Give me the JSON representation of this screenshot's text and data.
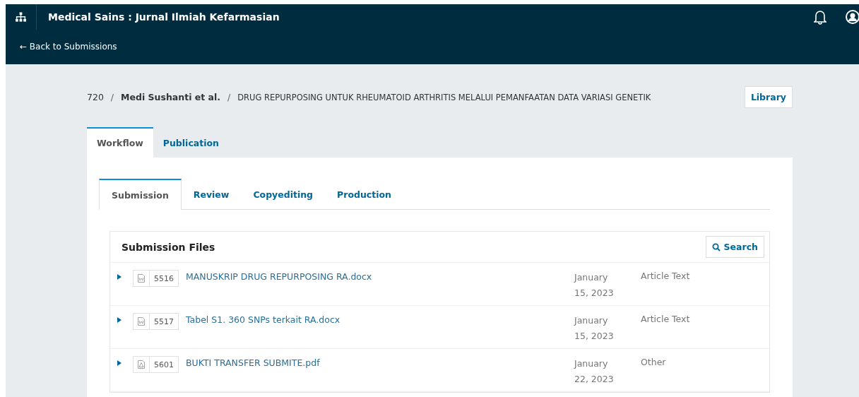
{
  "header": {
    "title": "Medical Sains : Jurnal Ilmiah Kefarmasian",
    "back_link": "← Back to Submissions"
  },
  "breadcrumb": {
    "id": "720",
    "authors": "Medi Sushanti et al.",
    "title": "DRUG REPURPOSING UNTUK RHEUMATOID ARTHRITIS MELALUI PEMANFAATAN DATA VARIASI GENETIK",
    "separator": "/"
  },
  "library_button": "Library",
  "tabs": [
    {
      "label": "Workflow",
      "selected": true
    },
    {
      "label": "Publication",
      "selected": false
    }
  ],
  "stage_tabs": [
    {
      "label": "Submission",
      "selected": true
    },
    {
      "label": "Review",
      "selected": false
    },
    {
      "label": "Copyediting",
      "selected": false
    },
    {
      "label": "Production",
      "selected": false
    }
  ],
  "files_panel": {
    "title": "Submission Files",
    "search_button": "Search",
    "rows": [
      {
        "kind": "word",
        "id": "5516",
        "name": "MANUSKRIP DRUG REPURPOSING RA.docx",
        "date": [
          "January",
          "15, 2023"
        ],
        "component": "Article Text"
      },
      {
        "kind": "word",
        "id": "5517",
        "name": "Tabel S1. 360 SNPs terkait RA.docx",
        "date": [
          "January",
          "15, 2023"
        ],
        "component": "Article Text"
      },
      {
        "kind": "pdf",
        "id": "5601",
        "name": "BUKTI TRANSFER SUBMITE.pdf",
        "date": [
          "January",
          "22, 2023"
        ],
        "component": "Other"
      }
    ]
  }
}
